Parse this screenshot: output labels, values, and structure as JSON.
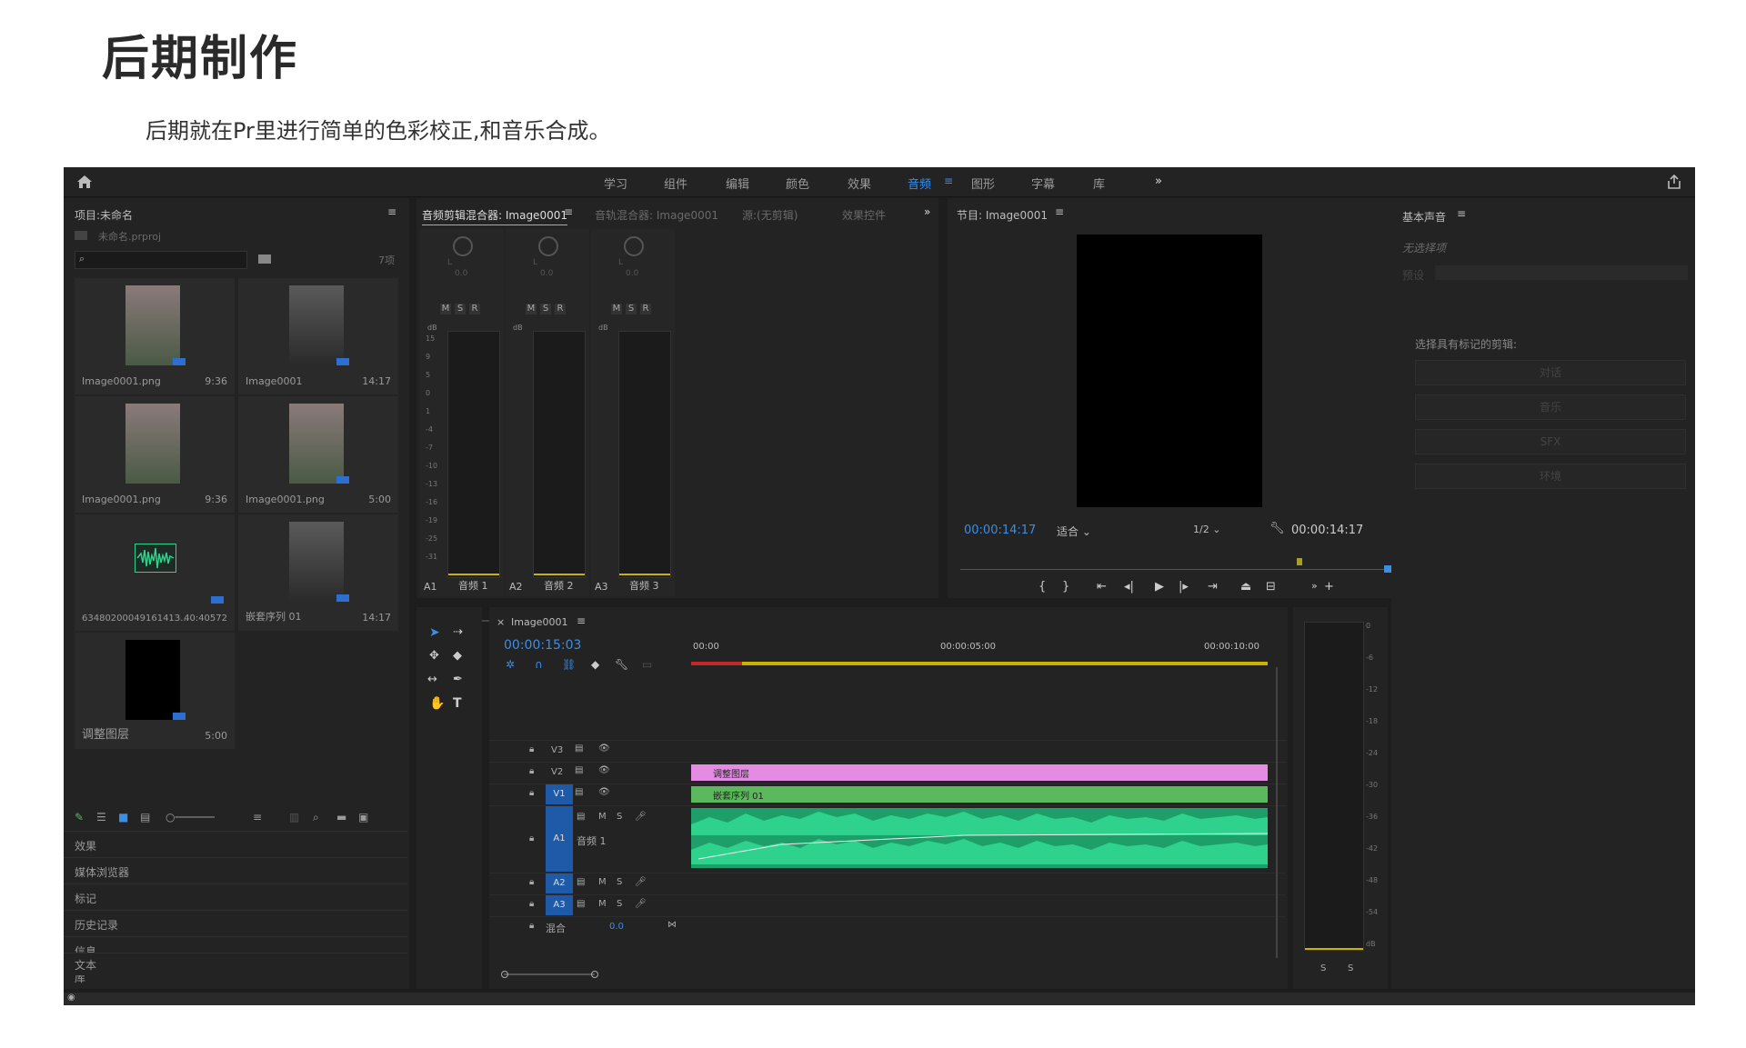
{
  "doc": {
    "title": "后期制作",
    "subtitle": "后期就在Pr里进行简单的色彩校正,和音乐合成。"
  },
  "topbar": {
    "tabs": [
      "学习",
      "组件",
      "编辑",
      "颜色",
      "效果",
      "音频",
      "图形",
      "字幕",
      "库"
    ],
    "active_tab": "音频",
    "more": "»"
  },
  "project": {
    "title": "项目:未命名",
    "file": "未命名.prproj",
    "count": "7项",
    "items": [
      {
        "name": "Image0001.png",
        "dur": "9:36"
      },
      {
        "name": "Image0001",
        "dur": "14:17"
      },
      {
        "name": "Image0001.png",
        "dur": "9:36"
      },
      {
        "name": "Image0001.png",
        "dur": "5:00"
      },
      {
        "name": "6348020004916141З...",
        "dur": "40:40572"
      },
      {
        "name": "嵌套序列 01",
        "dur": "14:17"
      },
      {
        "name": "调整图层",
        "dur": "5:00"
      }
    ],
    "side_list": [
      "效果",
      "媒体浏览器",
      "标记",
      "历史记录",
      "信息",
      "库",
      "文本"
    ]
  },
  "mixer": {
    "tabs": [
      "音频剪辑混合器: Image0001",
      "音轨混合器: Image0001",
      "源:(无剪辑)",
      "效果控件"
    ],
    "channels": [
      {
        "id": "A1",
        "name": "音频 1",
        "val": "0.0"
      },
      {
        "id": "A2",
        "name": "音频 2",
        "val": "0.0"
      },
      {
        "id": "A3",
        "name": "音频 3",
        "val": "0.0"
      }
    ],
    "lr": "L",
    "msr": [
      "M",
      "S",
      "R"
    ],
    "db_label": "dB",
    "db_ticks": [
      "15",
      "9",
      "5",
      "0",
      "1",
      "-4",
      "-7",
      "-10",
      "-13",
      "-16",
      "-19",
      "-25",
      "-31"
    ]
  },
  "program": {
    "title": "节目: Image0001",
    "timecode_left": "00:00:14:17",
    "fit": "适合",
    "resolution": "1/2",
    "timecode_right": "00:00:14:17"
  },
  "essential_sound": {
    "title": "基本声音",
    "no_selection": "无选择项",
    "preset_label": "预设",
    "prompt": "选择具有标记的剪辑:",
    "buttons": [
      "对话",
      "音乐",
      "SFX",
      "环境"
    ]
  },
  "timeline": {
    "seq_name": "Image0001",
    "timecode": "00:00:15:03",
    "ruler": [
      "00:00",
      "00:00:05:00",
      "00:00:10:00"
    ],
    "tracks": [
      "V3",
      "V2",
      "V1",
      "A1",
      "A2",
      "A3"
    ],
    "a1_name": "音频 1",
    "mix_label": "混合",
    "mix_val": "0.0",
    "clip_v2": "调整图层",
    "clip_v1": "嵌套序列 01"
  },
  "audio_meter": {
    "ticks": [
      "0",
      "-6",
      "-12",
      "-18",
      "-24",
      "-30",
      "-36",
      "-42",
      "-48",
      "-54",
      "dB"
    ],
    "solo": [
      "S",
      "S"
    ]
  },
  "colors": {
    "accent": "#3a8ee6",
    "clip_pink": "#e48ce4",
    "clip_green": "#5cb85c",
    "audio_green": "#2fd28c",
    "yellow": "#c8b400"
  }
}
